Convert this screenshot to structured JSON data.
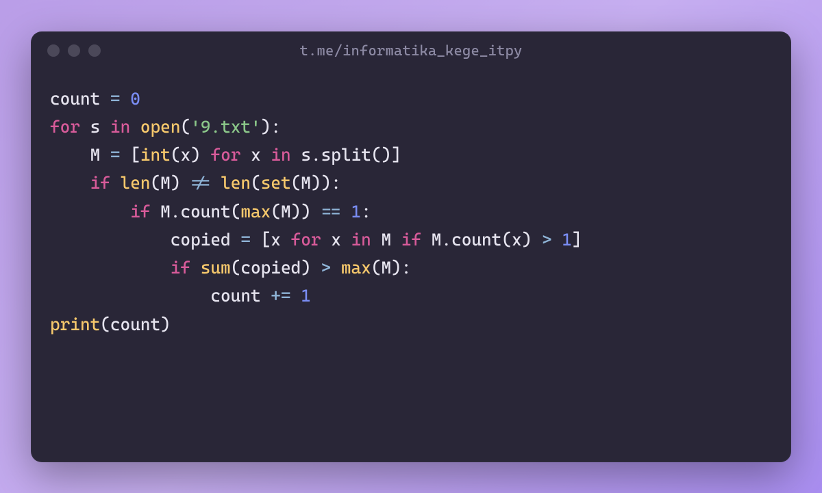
{
  "window": {
    "title": "t.me/informatika_kege_itpy"
  },
  "colors": {
    "background_gradient_from": "#ba9ee8",
    "background_gradient_to": "#a98ef0",
    "window_bg": "#292637",
    "title_fg": "#8c89a3",
    "traffic_light": "#4b4859",
    "code_fg": "#e6e4ef",
    "keyword": "#d85b9a",
    "builtin": "#f6c86c",
    "number": "#7a8df4",
    "string": "#8bc789",
    "operator": "#8eb3d6"
  },
  "code": {
    "language": "python",
    "indent": "    ",
    "tokens": [
      [
        [
          "id",
          "count"
        ],
        [
          "sp",
          " "
        ],
        [
          "op",
          "="
        ],
        [
          "sp",
          " "
        ],
        [
          "num",
          "0"
        ]
      ],
      [
        [
          "kw",
          "for"
        ],
        [
          "sp",
          " "
        ],
        [
          "id",
          "s"
        ],
        [
          "sp",
          " "
        ],
        [
          "kw",
          "in"
        ],
        [
          "sp",
          " "
        ],
        [
          "fn",
          "open"
        ],
        [
          "punc",
          "("
        ],
        [
          "str",
          "'9.txt'"
        ],
        [
          "punc",
          ")"
        ],
        [
          "punc",
          ":"
        ]
      ],
      [
        [
          "indent",
          1
        ],
        [
          "id",
          "M"
        ],
        [
          "sp",
          " "
        ],
        [
          "op",
          "="
        ],
        [
          "sp",
          " "
        ],
        [
          "punc",
          "["
        ],
        [
          "fn",
          "int"
        ],
        [
          "punc",
          "("
        ],
        [
          "id",
          "x"
        ],
        [
          "punc",
          ")"
        ],
        [
          "sp",
          " "
        ],
        [
          "kw",
          "for"
        ],
        [
          "sp",
          " "
        ],
        [
          "id",
          "x"
        ],
        [
          "sp",
          " "
        ],
        [
          "kw",
          "in"
        ],
        [
          "sp",
          " "
        ],
        [
          "id",
          "s"
        ],
        [
          "punc",
          "."
        ],
        [
          "id",
          "split"
        ],
        [
          "punc",
          "("
        ],
        [
          "punc",
          ")"
        ],
        [
          "punc",
          "]"
        ]
      ],
      [
        [
          "indent",
          1
        ],
        [
          "kw",
          "if"
        ],
        [
          "sp",
          " "
        ],
        [
          "fn",
          "len"
        ],
        [
          "punc",
          "("
        ],
        [
          "id",
          "M"
        ],
        [
          "punc",
          ")"
        ],
        [
          "sp",
          " "
        ],
        [
          "op",
          "!="
        ],
        [
          "sp",
          " "
        ],
        [
          "fn",
          "len"
        ],
        [
          "punc",
          "("
        ],
        [
          "fn",
          "set"
        ],
        [
          "punc",
          "("
        ],
        [
          "id",
          "M"
        ],
        [
          "punc",
          ")"
        ],
        [
          "punc",
          ")"
        ],
        [
          "punc",
          ":"
        ]
      ],
      [
        [
          "indent",
          2
        ],
        [
          "kw",
          "if"
        ],
        [
          "sp",
          " "
        ],
        [
          "id",
          "M"
        ],
        [
          "punc",
          "."
        ],
        [
          "id",
          "count"
        ],
        [
          "punc",
          "("
        ],
        [
          "fn",
          "max"
        ],
        [
          "punc",
          "("
        ],
        [
          "id",
          "M"
        ],
        [
          "punc",
          ")"
        ],
        [
          "punc",
          ")"
        ],
        [
          "sp",
          " "
        ],
        [
          "op",
          "=="
        ],
        [
          "sp",
          " "
        ],
        [
          "num",
          "1"
        ],
        [
          "punc",
          ":"
        ]
      ],
      [
        [
          "indent",
          3
        ],
        [
          "id",
          "copied"
        ],
        [
          "sp",
          " "
        ],
        [
          "op",
          "="
        ],
        [
          "sp",
          " "
        ],
        [
          "punc",
          "["
        ],
        [
          "id",
          "x"
        ],
        [
          "sp",
          " "
        ],
        [
          "kw",
          "for"
        ],
        [
          "sp",
          " "
        ],
        [
          "id",
          "x"
        ],
        [
          "sp",
          " "
        ],
        [
          "kw",
          "in"
        ],
        [
          "sp",
          " "
        ],
        [
          "id",
          "M"
        ],
        [
          "sp",
          " "
        ],
        [
          "kw",
          "if"
        ],
        [
          "sp",
          " "
        ],
        [
          "id",
          "M"
        ],
        [
          "punc",
          "."
        ],
        [
          "id",
          "count"
        ],
        [
          "punc",
          "("
        ],
        [
          "id",
          "x"
        ],
        [
          "punc",
          ")"
        ],
        [
          "sp",
          " "
        ],
        [
          "op",
          ">"
        ],
        [
          "sp",
          " "
        ],
        [
          "num",
          "1"
        ],
        [
          "punc",
          "]"
        ]
      ],
      [
        [
          "indent",
          3
        ],
        [
          "kw",
          "if"
        ],
        [
          "sp",
          " "
        ],
        [
          "fn",
          "sum"
        ],
        [
          "punc",
          "("
        ],
        [
          "id",
          "copied"
        ],
        [
          "punc",
          ")"
        ],
        [
          "sp",
          " "
        ],
        [
          "op",
          ">"
        ],
        [
          "sp",
          " "
        ],
        [
          "fn",
          "max"
        ],
        [
          "punc",
          "("
        ],
        [
          "id",
          "M"
        ],
        [
          "punc",
          ")"
        ],
        [
          "punc",
          ":"
        ]
      ],
      [
        [
          "indent",
          4
        ],
        [
          "id",
          "count"
        ],
        [
          "sp",
          " "
        ],
        [
          "op",
          "+="
        ],
        [
          "sp",
          " "
        ],
        [
          "num",
          "1"
        ]
      ],
      [
        [
          "fn",
          "print"
        ],
        [
          "punc",
          "("
        ],
        [
          "id",
          "count"
        ],
        [
          "punc",
          ")"
        ]
      ]
    ]
  }
}
